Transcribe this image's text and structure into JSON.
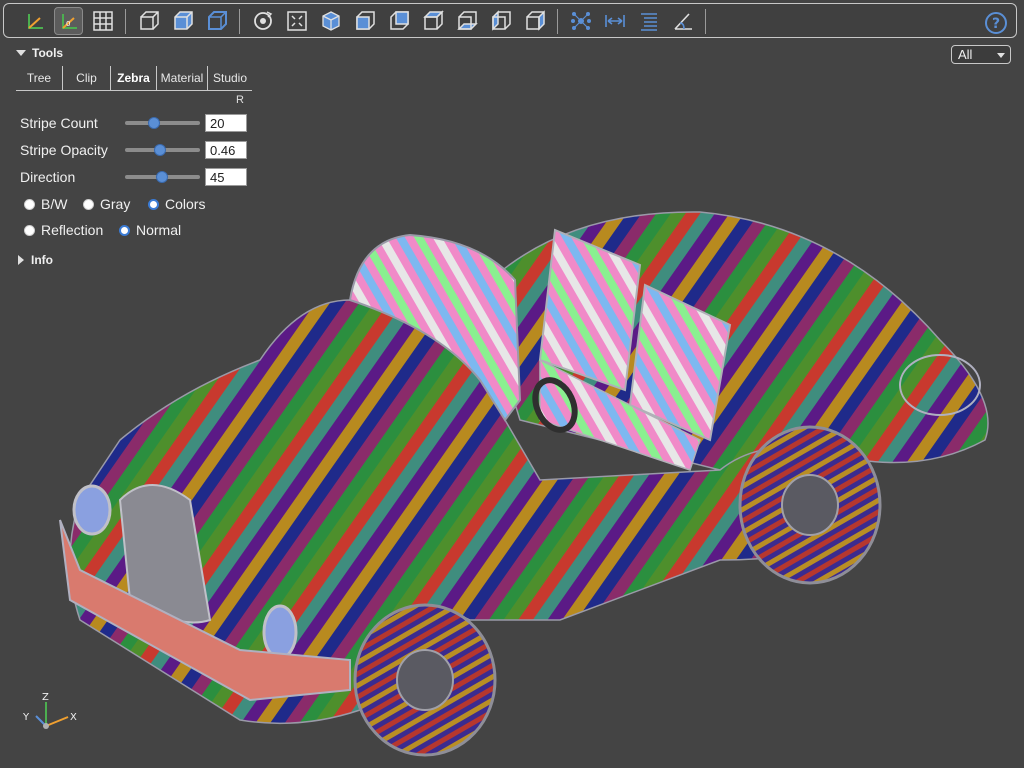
{
  "toolbar": {
    "buttons": [
      "axes-icon",
      "axes-origin-icon",
      "grid-icon",
      "perspective-icon",
      "ortho-icon",
      "transparent-icon",
      "reset-view-icon",
      "fit-icon",
      "iso-view-icon",
      "front-view-icon",
      "rear-view-icon",
      "top-view-icon",
      "bottom-view-icon",
      "left-view-icon",
      "right-view-icon",
      "explode-icon",
      "measure-icon",
      "properties-icon",
      "angle-icon"
    ],
    "help_icon": "help-icon"
  },
  "panel": {
    "title": "Tools",
    "tabs": [
      "Tree",
      "Clip",
      "Zebra",
      "Material",
      "Studio"
    ],
    "active_tab": "Zebra",
    "reverse_label": "R",
    "stripe_count_label": "Stripe Count",
    "stripe_count_value": "20",
    "stripe_opacity_label": "Stripe Opacity",
    "stripe_opacity_value": "0.46",
    "direction_label": "Direction",
    "direction_value": "45",
    "color_modes": [
      "B/W",
      "Gray",
      "Colors"
    ],
    "color_mode_selected": "Colors",
    "mapping_modes": [
      "Reflection",
      "Normal"
    ],
    "mapping_mode_selected": "Normal",
    "info_label": "Info"
  },
  "filter": {
    "selected": "All"
  },
  "axes": {
    "x": "X",
    "y": "Y",
    "z": "Z"
  },
  "colors": {
    "accent": "#3a7bd5",
    "background": "#444444"
  }
}
